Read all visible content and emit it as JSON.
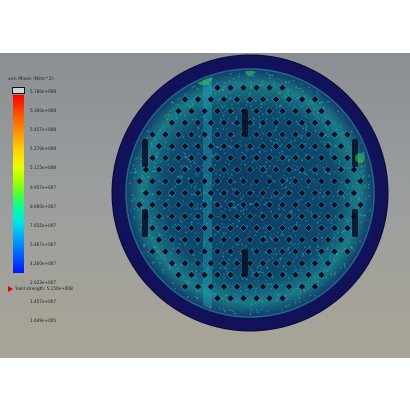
{
  "legend": {
    "title": "von Mises (N/m^2)",
    "ticks": [
      "5.780e+008",
      "5.300e+008",
      "5.457e+008",
      "5.270e+008",
      "5.115e+008",
      "9.957e+007",
      "8.660e+007",
      "7.655e+007",
      "5.467e+007",
      "4.260e+007",
      "2.623e+007",
      "1.457e+007",
      "1.649e+005"
    ],
    "yield_label": "Yield strength: 5.150e+008"
  },
  "colors": {
    "outer_ring": "#12125a",
    "plate_base": "#0c2a55",
    "mesh_cyan": "#1fb6c8",
    "mesh_green": "#3ccf5a",
    "hole": "#0a0d22",
    "yield_marker": "#e00000"
  }
}
